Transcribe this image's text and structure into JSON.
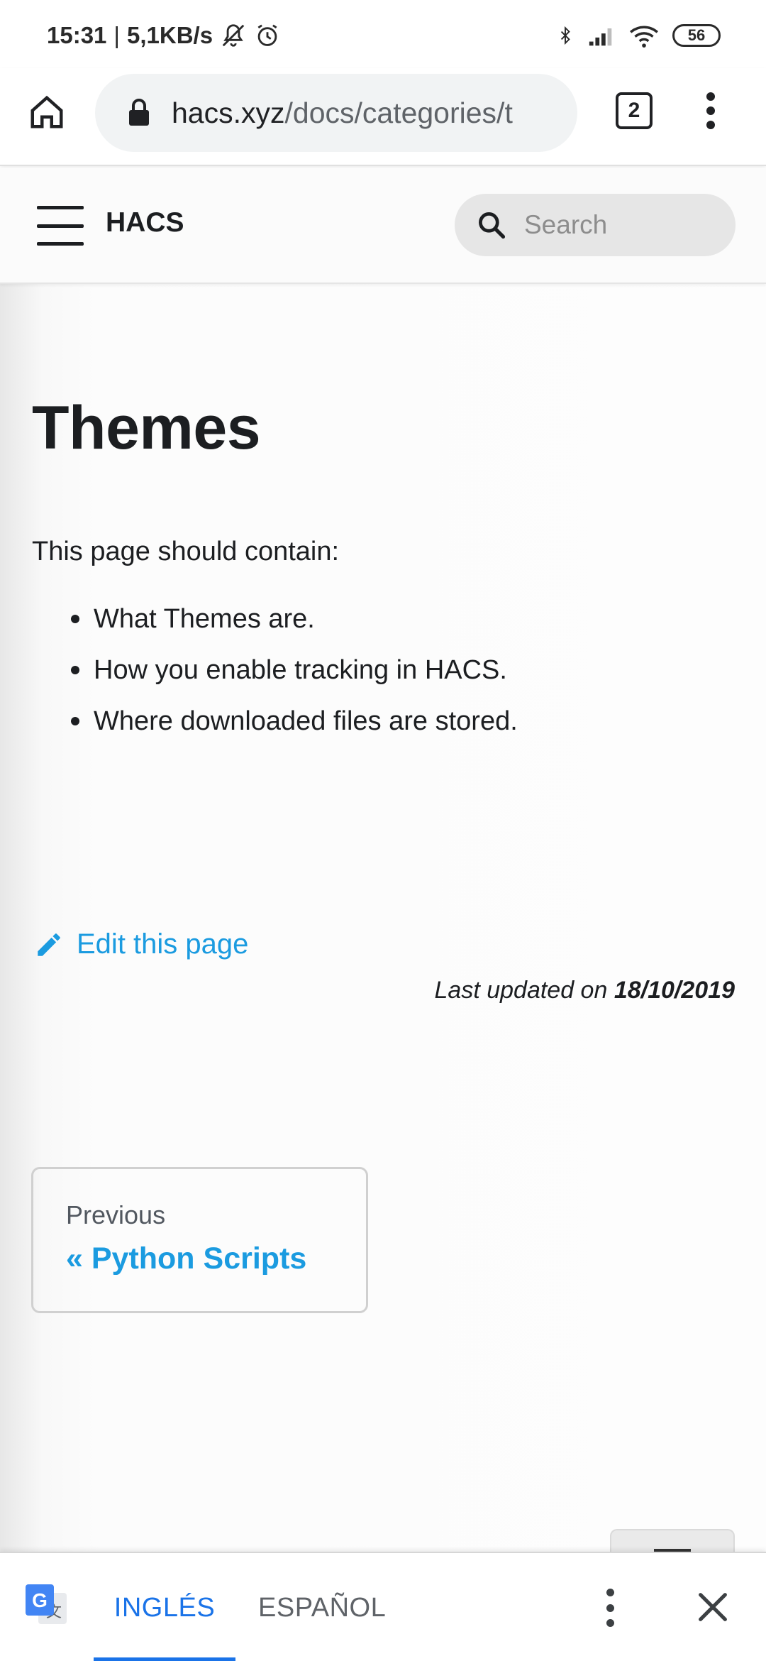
{
  "status_bar": {
    "time": "15:31",
    "speed": "5,1KB/s",
    "battery": "56",
    "icons": [
      "bell-off-icon",
      "alarm-icon",
      "bluetooth-icon",
      "signal-icon",
      "wifi-icon",
      "battery-icon"
    ]
  },
  "browser": {
    "url_host": "hacs.xyz",
    "url_path": "/docs/categories/t",
    "tab_count": "2"
  },
  "site": {
    "brand": "HACS",
    "search_placeholder": "Search"
  },
  "content": {
    "title": "Themes",
    "intro": "This page should contain:",
    "bullets": [
      "What Themes are.",
      "How you enable tracking in HACS.",
      "Where downloaded files are stored."
    ],
    "edit_label": "Edit this page",
    "last_updated_prefix": "Last updated on ",
    "last_updated_date": "18/10/2019",
    "pager_sub": "Previous",
    "pager_label": "« Python Scripts"
  },
  "translate": {
    "source_lang": "INGLÉS",
    "target_lang": "ESPAÑOL"
  },
  "colors": {
    "link": "#1b9be0",
    "translate_accent": "#1a73e8"
  }
}
